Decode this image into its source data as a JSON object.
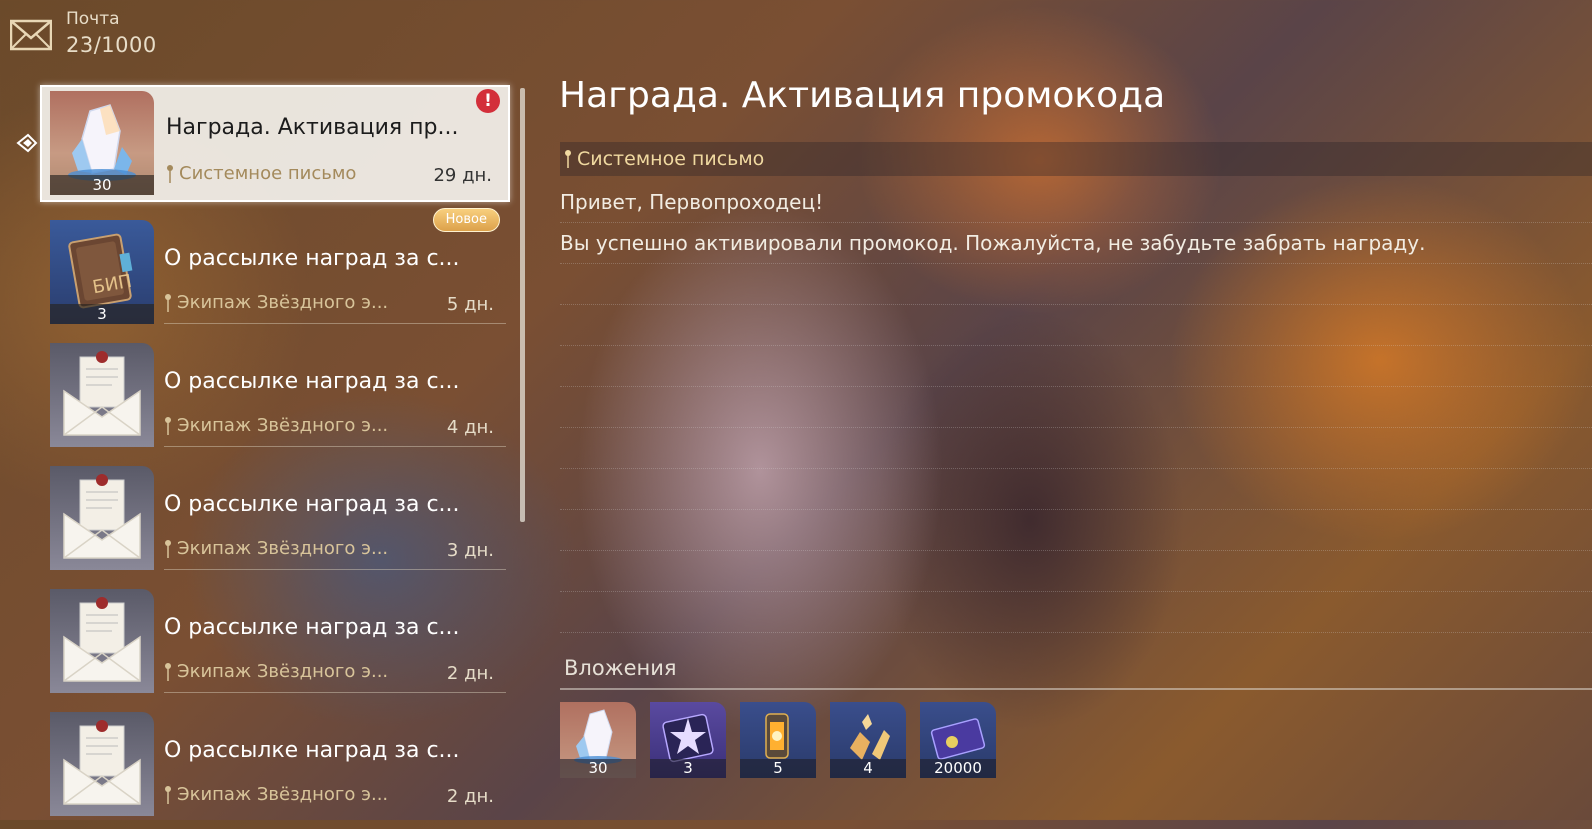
{
  "header": {
    "title": "Почта",
    "count": "23/1000"
  },
  "mails": [
    {
      "title": "Награда. Активация пр...",
      "sender": "Системное письмо",
      "days": "29 дн.",
      "thumb_count": "30",
      "thumb": "crystal-icon",
      "selected": true,
      "alert": "!"
    },
    {
      "title": "О рассылке наград за с...",
      "sender": "Экипаж Звёздного э...",
      "days": "5 дн.",
      "thumb_count": "3",
      "thumb": "book-icon",
      "badge": "Новое"
    },
    {
      "title": "О рассылке наград за с...",
      "sender": "Экипаж Звёздного э...",
      "days": "4 дн.",
      "thumb": "envelope-icon"
    },
    {
      "title": "О рассылке наград за с...",
      "sender": "Экипаж Звёздного э...",
      "days": "3 дн.",
      "thumb": "envelope-icon"
    },
    {
      "title": "О рассылке наград за с...",
      "sender": "Экипаж Звёздного э...",
      "days": "2 дн.",
      "thumb": "envelope-icon"
    },
    {
      "title": "О рассылке наград за с...",
      "sender": "Экипаж Звёздного э...",
      "days": "2 дн.",
      "thumb": "envelope-icon"
    }
  ],
  "detail": {
    "title": "Награда. Активация промокода",
    "sender": "Системное письмо",
    "body": [
      "Привет, Первопроходец!",
      "Вы успешно активировали промокод. Пожалуйста, не забудьте забрать награду."
    ]
  },
  "attachments": {
    "title": "Вложения",
    "items": [
      {
        "icon": "crystal-icon",
        "count": "30"
      },
      {
        "icon": "star-pass-icon",
        "count": "3"
      },
      {
        "icon": "lantern-icon",
        "count": "5"
      },
      {
        "icon": "ore-icon",
        "count": "4"
      },
      {
        "icon": "credit-card-icon",
        "count": "20000"
      }
    ]
  }
}
